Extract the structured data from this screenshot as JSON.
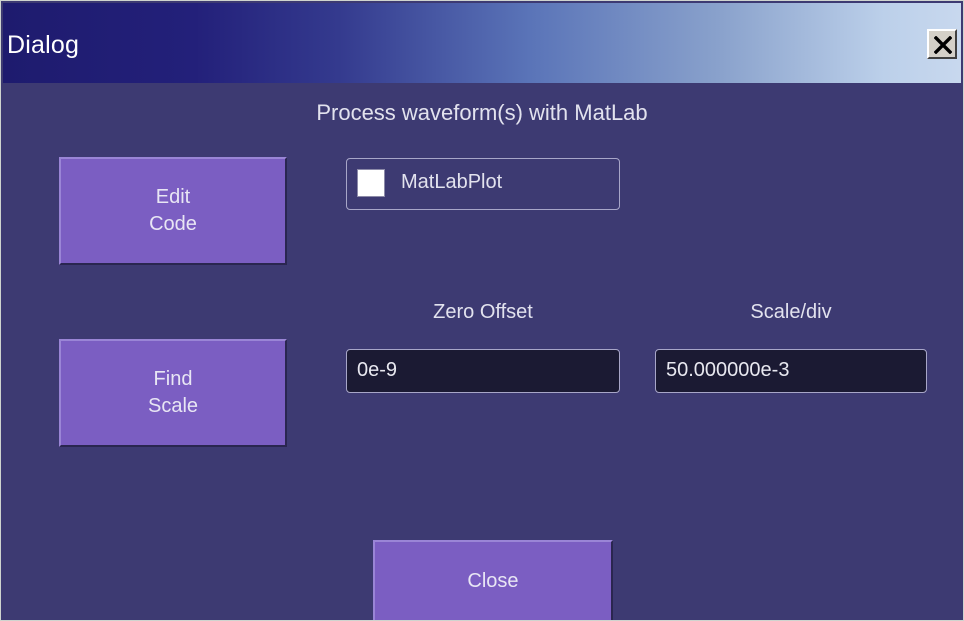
{
  "window": {
    "title": "Dialog"
  },
  "dialog": {
    "heading": "Process waveform(s) with MatLab",
    "edit_code_button": {
      "line1": "Edit",
      "line2": "Code"
    },
    "find_scale_button": {
      "line1": "Find",
      "line2": "Scale"
    },
    "matlab_plot_checkbox": {
      "label": "MatLabPlot",
      "checked": false
    },
    "zero_offset": {
      "label": "Zero Offset",
      "value": "0e-9"
    },
    "scale_div": {
      "label": "Scale/div",
      "value": "50.000000e-3"
    },
    "close_button": {
      "label": "Close"
    }
  },
  "icons": {
    "title_close": "close-icon"
  },
  "colors": {
    "background": "#3d3a72",
    "button": "#7b5ec2",
    "field": "#1b1a33"
  }
}
